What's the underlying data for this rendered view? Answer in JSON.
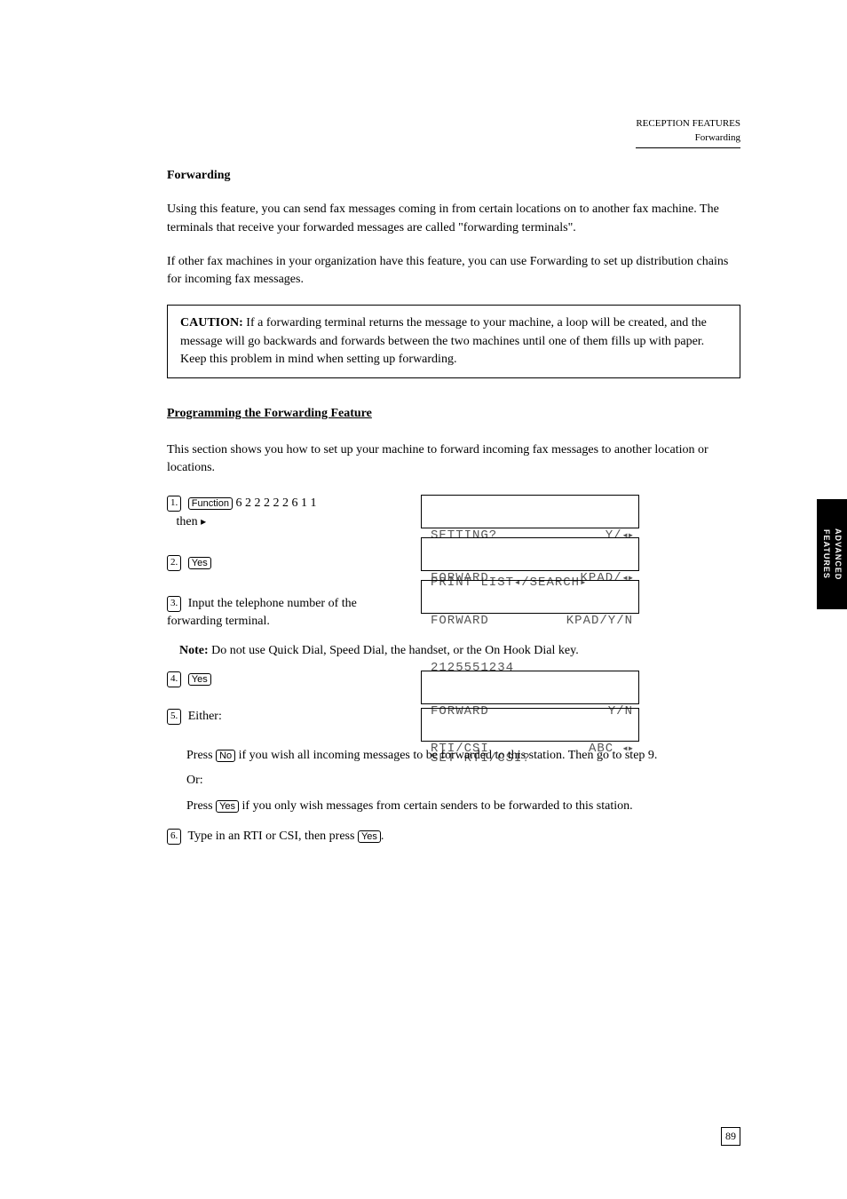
{
  "header": {
    "line1": "RECEPTION FEATURES",
    "line2": "Forwarding"
  },
  "section_title": "Forwarding",
  "para1": "Using this feature, you can send fax messages coming in from certain locations on to another fax machine. The terminals that receive your forwarded messages are called \"forwarding terminals\".",
  "para2": "If other fax machines in your organization have this feature, you can use Forwarding to set up distribution chains for incoming fax messages.",
  "caution": {
    "label": "CAUTION:",
    "text": " If a forwarding terminal returns the message to your machine, a loop will be created, and the message will go backwards and forwards between the two machines until one of them fills up with paper. Keep this problem in mind when setting up forwarding."
  },
  "subhead": "Programming the Forwarding Feature",
  "intro": "This section shows you how to set up your machine to forward incoming fax messages to another location or locations.",
  "step1_a": "Function",
  "step1_b": "6 2 2 2 2 2 6 1 1",
  "step1_c": "then ",
  "lcd": {
    "r1c1": "SETTING?",
    "r1c2_pre": "Y/",
    "r2c1_pre": "PRINT LIST",
    "r2c1_mid": "/SEARCH",
    "r3c1": "FORWARD",
    "r3c2_pre": "KPAD/",
    "r4c1": "FORWARD",
    "r4c2": "KPAD/Y/N",
    "r5": "2125551234",
    "r6c1": "FORWARD",
    "r6c2": "Y/N",
    "r7": "SET RTI/CSI?",
    "r8c1": "RTI/CSI",
    "r8c2_pre": "ABC "
  },
  "step2": "Yes",
  "step3_a": "Input the telephone number of the forwarding terminal.",
  "note_label": "Note:",
  "note_text": " Do not use Quick Dial, Speed Dial, the handset, or the On Hook Dial key.",
  "step4": "Yes",
  "step5_intro": "Either:",
  "step5_opt1_pre": "Press ",
  "step5_opt1_key": "No",
  "step5_opt1_post": " if you wish all incoming messages to be forwarded to this station. Then go to step 9.",
  "step5_or": "Or:",
  "step5_opt2_pre": "Press ",
  "step5_opt2_key": "Yes",
  "step5_opt2_post": " if you only wish messages from certain senders to be forwarded to this station.",
  "step6_text": "Type in an RTI or CSI, then press ",
  "step6_key": "Yes",
  "step6_tail": ".",
  "tab": "ADVANCED FEATURES",
  "pagenum": "89"
}
